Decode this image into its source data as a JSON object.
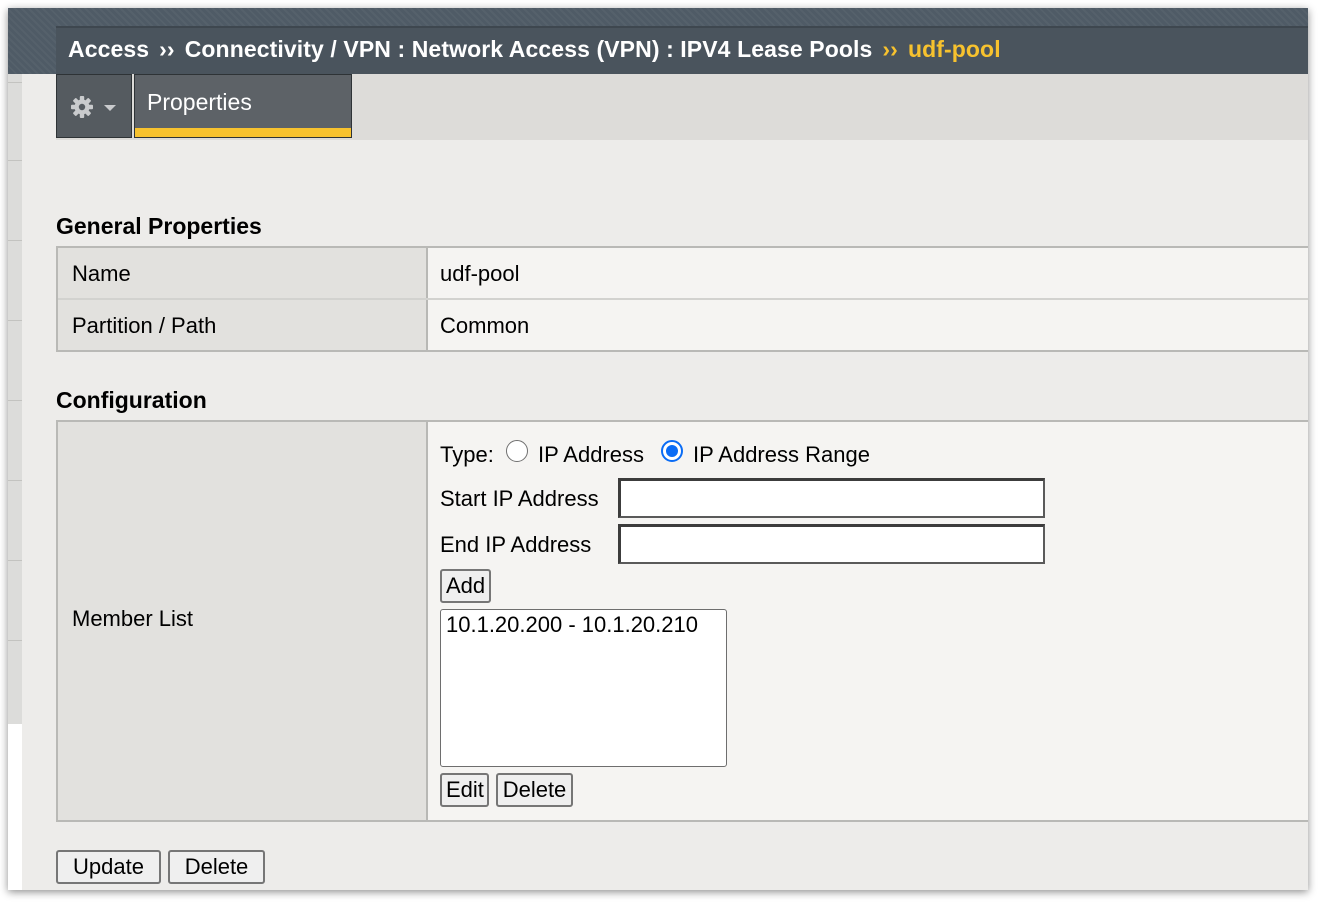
{
  "breadcrumb": {
    "items": [
      "Access",
      "Connectivity / VPN : Network Access (VPN) : IPV4 Lease Pools"
    ],
    "separator": "››",
    "current": "udf-pool"
  },
  "tabs": {
    "gear_menu": "gear-icon",
    "active_tab": "Properties"
  },
  "general": {
    "title": "General Properties",
    "rows": [
      {
        "label": "Name",
        "value": "udf-pool"
      },
      {
        "label": "Partition / Path",
        "value": "Common"
      }
    ]
  },
  "configuration": {
    "title": "Configuration",
    "member_list_label": "Member List",
    "type_label": "Type:",
    "type_options": [
      "IP Address",
      "IP Address Range"
    ],
    "type_selected": "IP Address Range",
    "start_ip_label": "Start IP Address",
    "start_ip_value": "",
    "end_ip_label": "End IP Address",
    "end_ip_value": "",
    "add_label": "Add",
    "members": [
      "10.1.20.200 - 10.1.20.210"
    ],
    "edit_label": "Edit",
    "delete_label": "Delete"
  },
  "footer": {
    "update_label": "Update",
    "delete_label": "Delete"
  },
  "colors": {
    "header_bg": "#4f5b66",
    "accent_yellow": "#f7c22e",
    "radio_blue": "#0a6cf5"
  }
}
